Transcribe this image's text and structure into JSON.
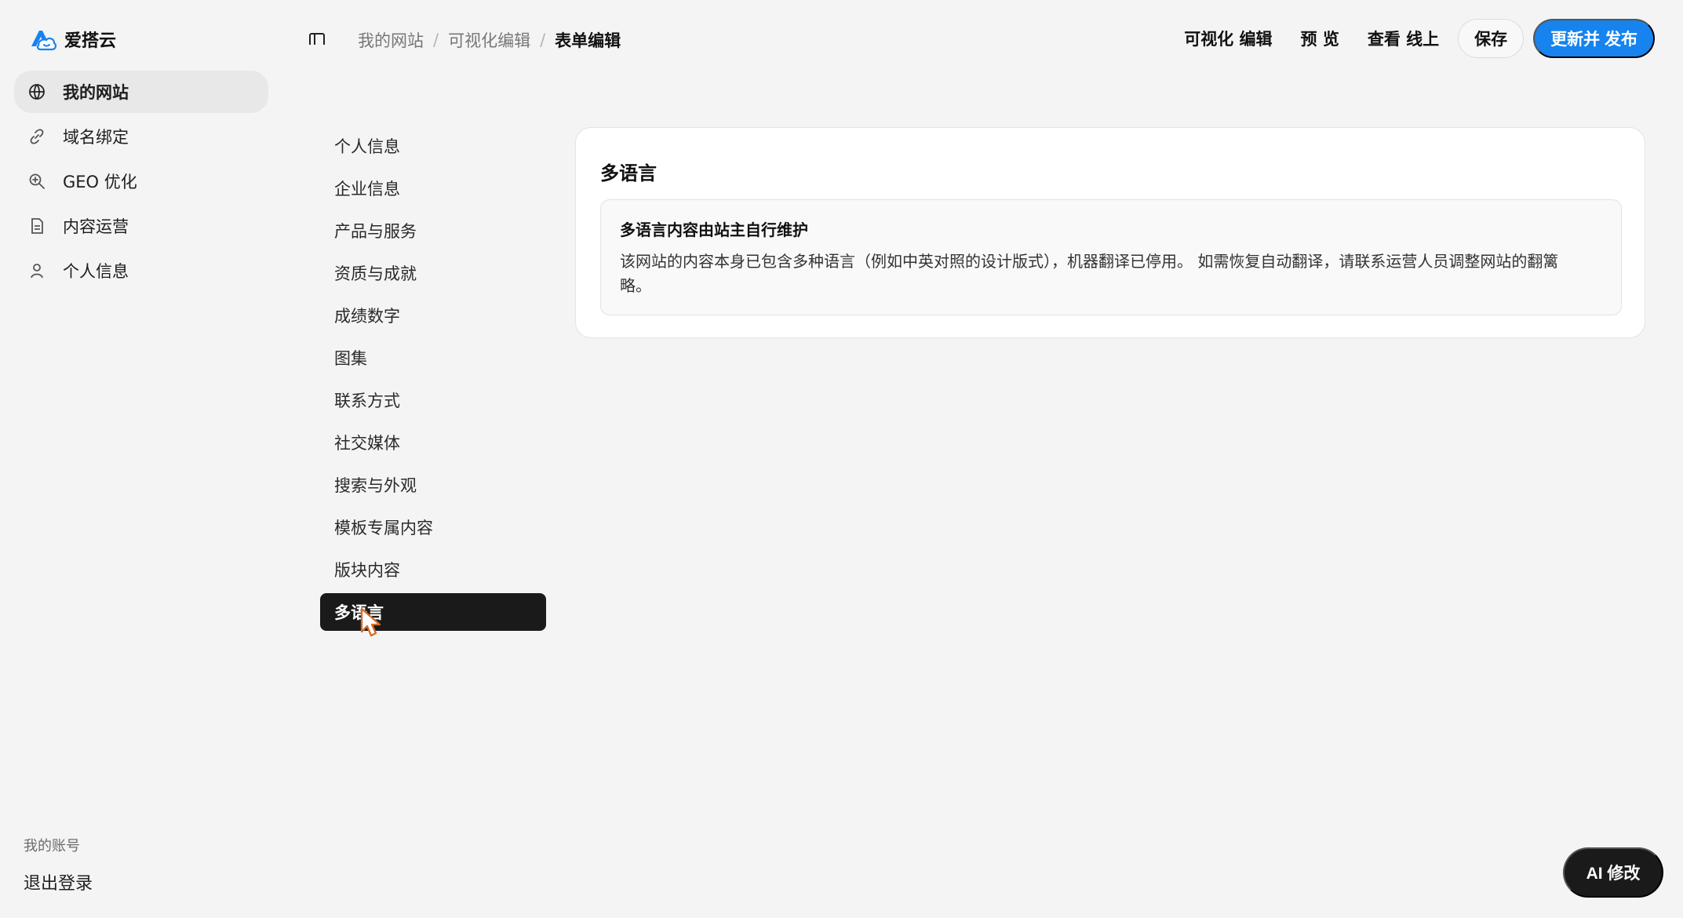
{
  "brand": {
    "name": "爱搭云",
    "logo_icon": "cloud-logo-icon"
  },
  "sidebar": {
    "items": [
      {
        "label": "我的网站",
        "icon": "globe-icon",
        "active": true
      },
      {
        "label": "域名绑定",
        "icon": "link-icon",
        "active": false
      },
      {
        "label": "GEO 优化",
        "icon": "search-plus-icon",
        "active": false
      },
      {
        "label": "内容运营",
        "icon": "document-icon",
        "active": false
      },
      {
        "label": "个人信息",
        "icon": "user-icon",
        "active": false
      }
    ],
    "account_label": "我的账号",
    "logout_label": "退出登录"
  },
  "topbar": {
    "toggle_icon": "sidebar-toggle-icon",
    "breadcrumb": [
      {
        "label": "我的网站"
      },
      {
        "label": "可视化编辑"
      },
      {
        "label": "表单编辑"
      }
    ],
    "separator": "/",
    "actions": {
      "visual_edit": "可视化  编辑",
      "preview": "预  览",
      "view_online": "查看  线上",
      "save": "保存",
      "publish": "更新并  发布"
    },
    "publish_color": "#1683ef"
  },
  "form_menu": {
    "items": [
      {
        "label": "个人信息",
        "active": false
      },
      {
        "label": "企业信息",
        "active": false
      },
      {
        "label": "产品与服务",
        "active": false
      },
      {
        "label": "资质与成就",
        "active": false
      },
      {
        "label": "成绩数字",
        "active": false
      },
      {
        "label": "图集",
        "active": false
      },
      {
        "label": "联系方式",
        "active": false
      },
      {
        "label": "社交媒体",
        "active": false
      },
      {
        "label": "搜索与外观",
        "active": false
      },
      {
        "label": "模板专属内容",
        "active": false
      },
      {
        "label": "版块内容",
        "active": false
      },
      {
        "label": "多语言",
        "active": true
      }
    ]
  },
  "main": {
    "title": "多语言",
    "notice": {
      "title": "多语言内容由站主自行维护",
      "text": "该网站的内容本身已包含多种语言（例如中英对照的设计版式），机器翻译已停用。 如需恢复自动翻译，请联系运营人员调整网站的翻篱略。"
    }
  },
  "ai_button": {
    "label": "AI 修改"
  }
}
